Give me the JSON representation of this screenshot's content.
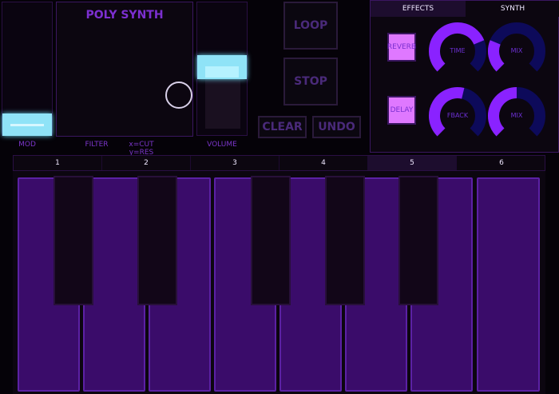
{
  "synth": {
    "title": "POLY SYNTH",
    "filter_label": "FILTER",
    "filter_hint": "x=CUT y=RES",
    "mod_label": "MOD",
    "volume_label": "VOLUME"
  },
  "transport": {
    "loop_label": "LOOP",
    "stop_label": "STOP",
    "clear_label": "CLEAR",
    "undo_label": "UNDO"
  },
  "tabs": [
    {
      "label": "EFFECTS",
      "active": true
    },
    {
      "label": "SYNTH",
      "active": false
    }
  ],
  "effects": {
    "reverb_label": "REVERB",
    "delay_label": "DELAY",
    "knobs": [
      {
        "label": "TIME",
        "value": 0.75
      },
      {
        "label": "MIX",
        "value": 0.25
      },
      {
        "label": "FBACK",
        "value": 0.55
      },
      {
        "label": "MIX",
        "value": 0.5
      }
    ]
  },
  "keyboard": {
    "octaves": [
      "1",
      "2",
      "3",
      "4",
      "5",
      "6"
    ],
    "selected_octave": "5"
  },
  "levels": {
    "mod": 0.12,
    "volume": 0.6
  },
  "colors": {
    "knob_fill": "#8a22ff",
    "knob_track": "#0d0a5a",
    "accent": "#7c2fd0",
    "slider_thumb": "#8fe3f7"
  },
  "icons": {
    "filter_pad_cursor": "circle-cursor-icon"
  }
}
